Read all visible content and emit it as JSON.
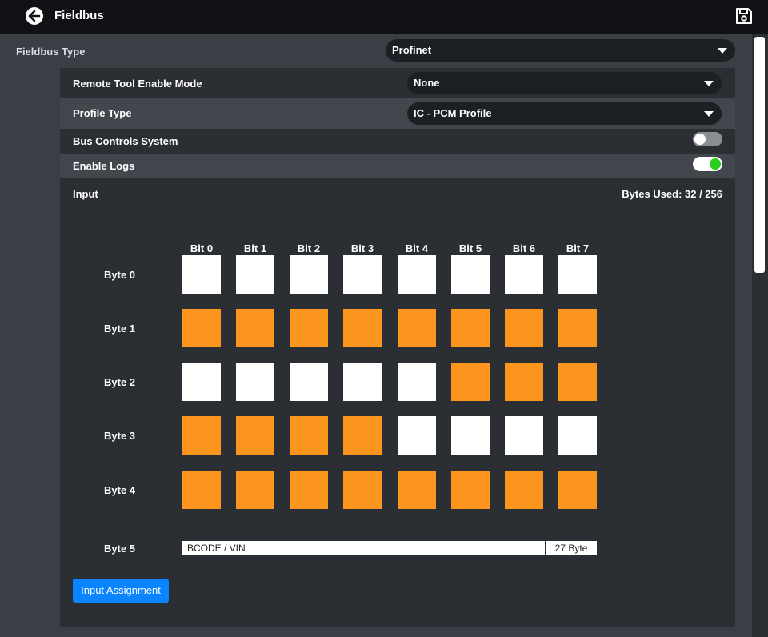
{
  "header": {
    "title": "Fieldbus"
  },
  "colors": {
    "accent": "#0a84ff",
    "bit_set": "#fb951d",
    "bit_clear": "#ffffff",
    "toggle_on": "#2ecc1f"
  },
  "fieldbus_type": {
    "label": "Fieldbus Type",
    "value": "Profinet"
  },
  "settings": {
    "remote_tool": {
      "label": "Remote Tool Enable Mode",
      "value": "None"
    },
    "profile_type": {
      "label": "Profile Type",
      "value": "IC - PCM Profile"
    },
    "bus_controls": {
      "label": "Bus Controls System",
      "enabled": false
    },
    "enable_logs": {
      "label": "Enable Logs",
      "enabled": true
    }
  },
  "input": {
    "title": "Input",
    "bytes_used": "Bytes Used: 32 / 256",
    "bit_headers": [
      "Bit 0",
      "Bit 1",
      "Bit 2",
      "Bit 3",
      "Bit 4",
      "Bit 5",
      "Bit 6",
      "Bit 7"
    ],
    "bytes": [
      {
        "label": "Byte 0",
        "bits": [
          0,
          0,
          0,
          0,
          0,
          0,
          0,
          0
        ]
      },
      {
        "label": "Byte 1",
        "bits": [
          1,
          1,
          1,
          1,
          1,
          1,
          1,
          1
        ]
      },
      {
        "label": "Byte 2",
        "bits": [
          0,
          0,
          0,
          0,
          0,
          1,
          1,
          1
        ]
      },
      {
        "label": "Byte 3",
        "bits": [
          1,
          1,
          1,
          1,
          0,
          0,
          0,
          0
        ]
      },
      {
        "label": "Byte 4",
        "bits": [
          1,
          1,
          1,
          1,
          1,
          1,
          1,
          1
        ]
      }
    ],
    "byte5": {
      "label": "Byte 5",
      "name": "BCODE / VIN",
      "size": "27 Byte"
    },
    "assign_button": "Input Assignment"
  }
}
